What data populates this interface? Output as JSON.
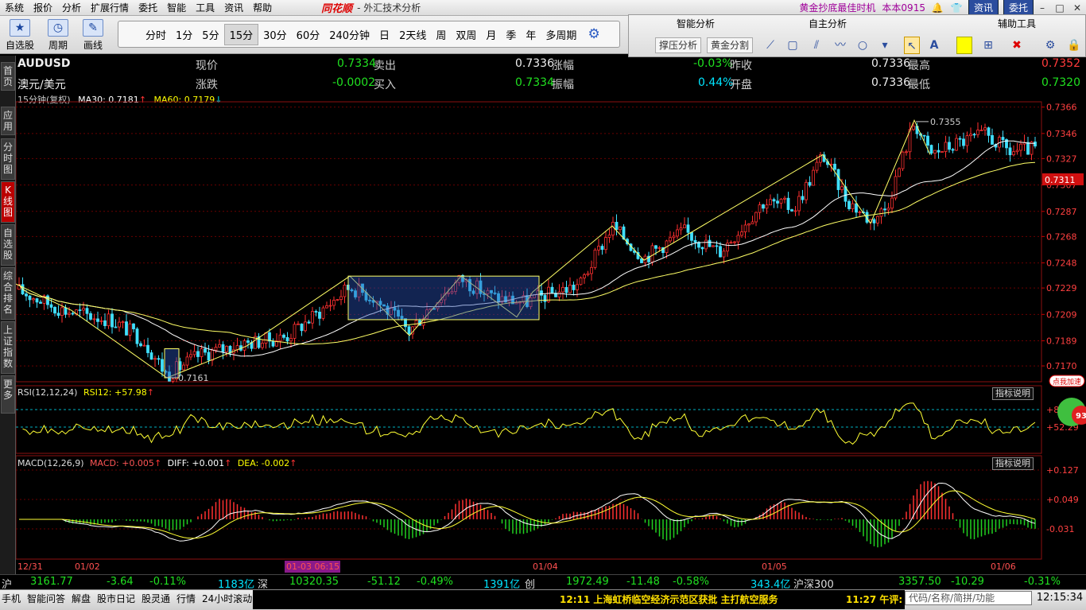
{
  "menubar": {
    "items": [
      "系统",
      "报价",
      "分析",
      "扩展行情",
      "委托",
      "智能",
      "工具",
      "资讯",
      "帮助"
    ],
    "logo": "同花顺",
    "app_title": "- 外汇技术分析",
    "promo": "黄金抄底最佳时机",
    "version": "本本0915",
    "btn_news": "资讯",
    "btn_trade": "委托"
  },
  "toolbar": {
    "big_buttons": [
      "自选股",
      "周期",
      "画线"
    ],
    "periods": [
      "分时",
      "1分",
      "5分",
      "15分",
      "30分",
      "60分",
      "240分钟",
      "日",
      "2天线",
      "周",
      "双周",
      "月",
      "季",
      "年",
      "多周期"
    ],
    "active_period": "15分"
  },
  "tool_panel": {
    "headers": [
      "智能分析",
      "自主分析",
      "辅助工具"
    ],
    "btn_support": "撑压分析",
    "btn_golden": "黄金分割",
    "text_tool": "A"
  },
  "sidetabs": [
    "首页",
    "应用",
    "分时图",
    "K线图",
    "自选股",
    "综合排名",
    "上证指数",
    "更多"
  ],
  "quote": {
    "symbol": "AUDUSD",
    "name": "澳元/美元",
    "price_label": "现价",
    "price": "0.7334",
    "sell_label": "卖出",
    "sell": "0.7336",
    "pct_label": "涨幅",
    "pct": "-0.03%",
    "prevclose_label": "昨收",
    "prevclose": "0.7336",
    "high_label": "最高",
    "high": "0.7352",
    "change_label": "涨跌",
    "change": "-0.0002",
    "buy_label": "买入",
    "buy": "0.7334",
    "amp_label": "振幅",
    "amp": "0.44%",
    "open_label": "开盘",
    "open": "0.7336",
    "low_label": "最低",
    "low": "0.7320"
  },
  "legend": {
    "period_text": "15分钟(复权)",
    "ma30": "MA30: 0.7181",
    "ma60": "MA60: 0.7179",
    "rsi": "RSI(12,12,24)",
    "rsi12": "RSI12: +57.98",
    "macd_name": "MACD(12,26,9)",
    "macd": "MACD: +0.005",
    "diff": "DIFF: +0.001",
    "dea": "DEA: -0.002",
    "ind_btn": "指标说明"
  },
  "chart_data": {
    "type": "candlestick",
    "symbol": "AUDUSD",
    "price_axis": [
      "0.7366",
      "0.7346",
      "0.7327",
      "0.7307",
      "0.7287",
      "0.7268",
      "0.7248",
      "0.7229",
      "0.7209",
      "0.7189",
      "0.7170"
    ],
    "price_range": [
      0.7158,
      0.737
    ],
    "current_price_tag": "0.7311",
    "annot_high": "0.7355",
    "annot_low": "0.7161",
    "date_labels": [
      "12/31",
      "01/02",
      "01-03 06:15",
      "01/04",
      "01/05",
      "01/06"
    ],
    "rsi_axis": [
      "+84",
      "+52.29"
    ],
    "macd_axis": [
      "+0.127",
      "+0.049",
      "-0.031"
    ],
    "colors": {
      "up": "#ff3030",
      "down": "#40e0ff",
      "ma30": "#ffffff",
      "ma60": "#ffff66",
      "hist_up": "#ff3030",
      "hist_down": "#20d020"
    }
  },
  "indexbar": {
    "sh_label": "沪",
    "sh_value": "3161.77",
    "sh_change": "-3.64",
    "sh_pct": "-0.11%",
    "sh_amount": "1183亿",
    "sz_label": "深",
    "sz_value": "10320.35",
    "sz_change": "-51.12",
    "sz_pct": "-0.49%",
    "sz_amount": "1391亿",
    "cy_label": "创",
    "cy_value": "1972.49",
    "cy_change": "-11.48",
    "cy_pct": "-0.58%",
    "cy_amount": "343.4亿",
    "hs_label": "沪深300",
    "hs_value": "3357.50",
    "hs_change": "-10.29",
    "hs_pct": "-0.31%"
  },
  "bottombar": {
    "items": [
      "手机",
      "智能问答",
      "解盘",
      "股市日记",
      "股灵通",
      "行情",
      "24小时滚动"
    ],
    "news": "12:11 上海虹桥临空经济示范区获批 主打航空服务",
    "news2": "11:27 午评:",
    "search_placeholder": "代码/名称/简拼/功能",
    "clock": "12:15:34"
  },
  "ad": {
    "text": "点我加速",
    "number": "93"
  }
}
